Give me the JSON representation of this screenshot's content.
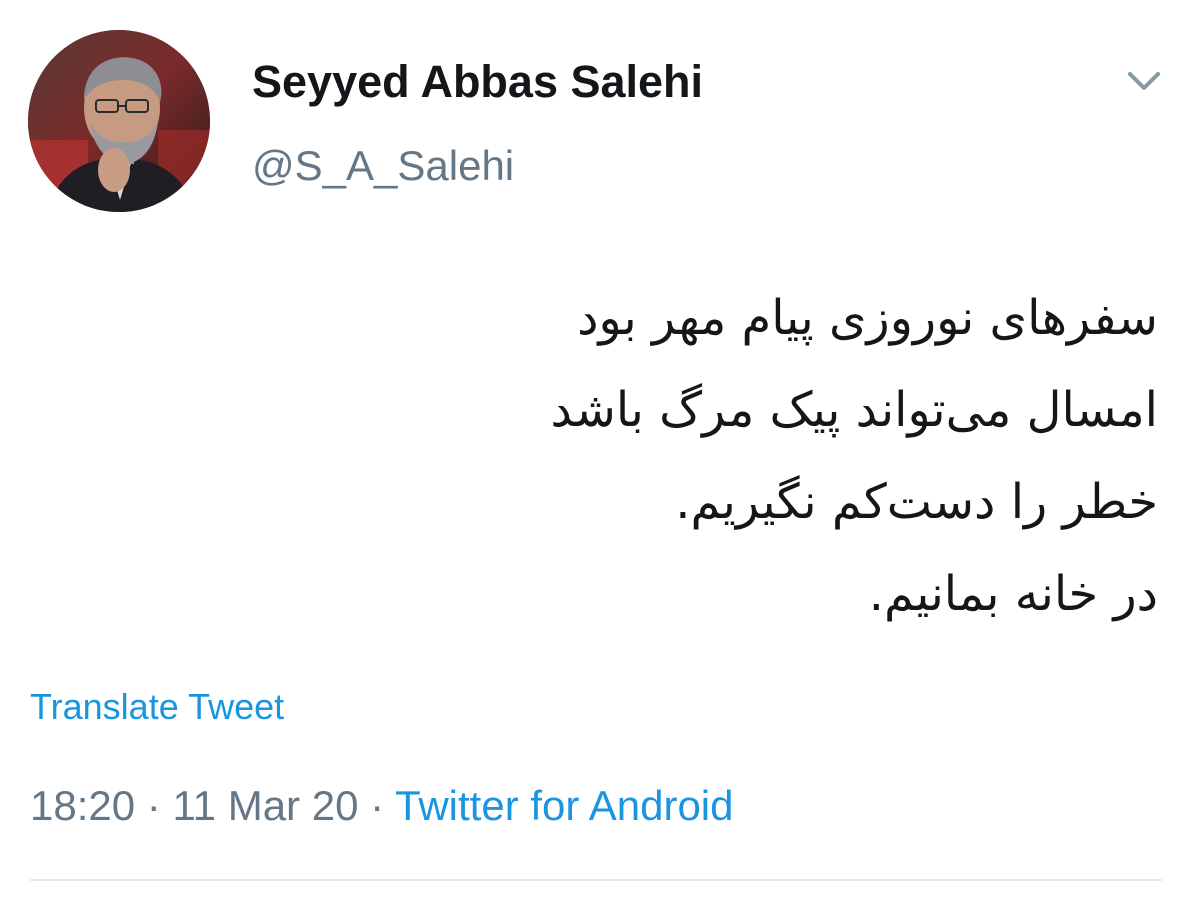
{
  "author": {
    "display_name": "Seyyed Abbas Salehi",
    "handle": "@S_A_Salehi",
    "avatar_icon": "profile-photo"
  },
  "menu": {
    "icon": "chevron-down-icon"
  },
  "tweet": {
    "lines": [
      "سفرهای نوروزی پیام مهر بود",
      "امسال می‌تواند پیک مرگ باشد",
      "خطر را دست‌کم نگیریم.",
      "در خانه بمانیم."
    ],
    "translate_label": "Translate Tweet"
  },
  "meta": {
    "time": "18:20",
    "separator": " · ",
    "date": "11 Mar 20",
    "source": "Twitter for Android"
  },
  "colors": {
    "link": "#1b95e0",
    "secondary_text": "#657786",
    "primary_text": "#14171a",
    "divider": "#e1e8ed"
  }
}
